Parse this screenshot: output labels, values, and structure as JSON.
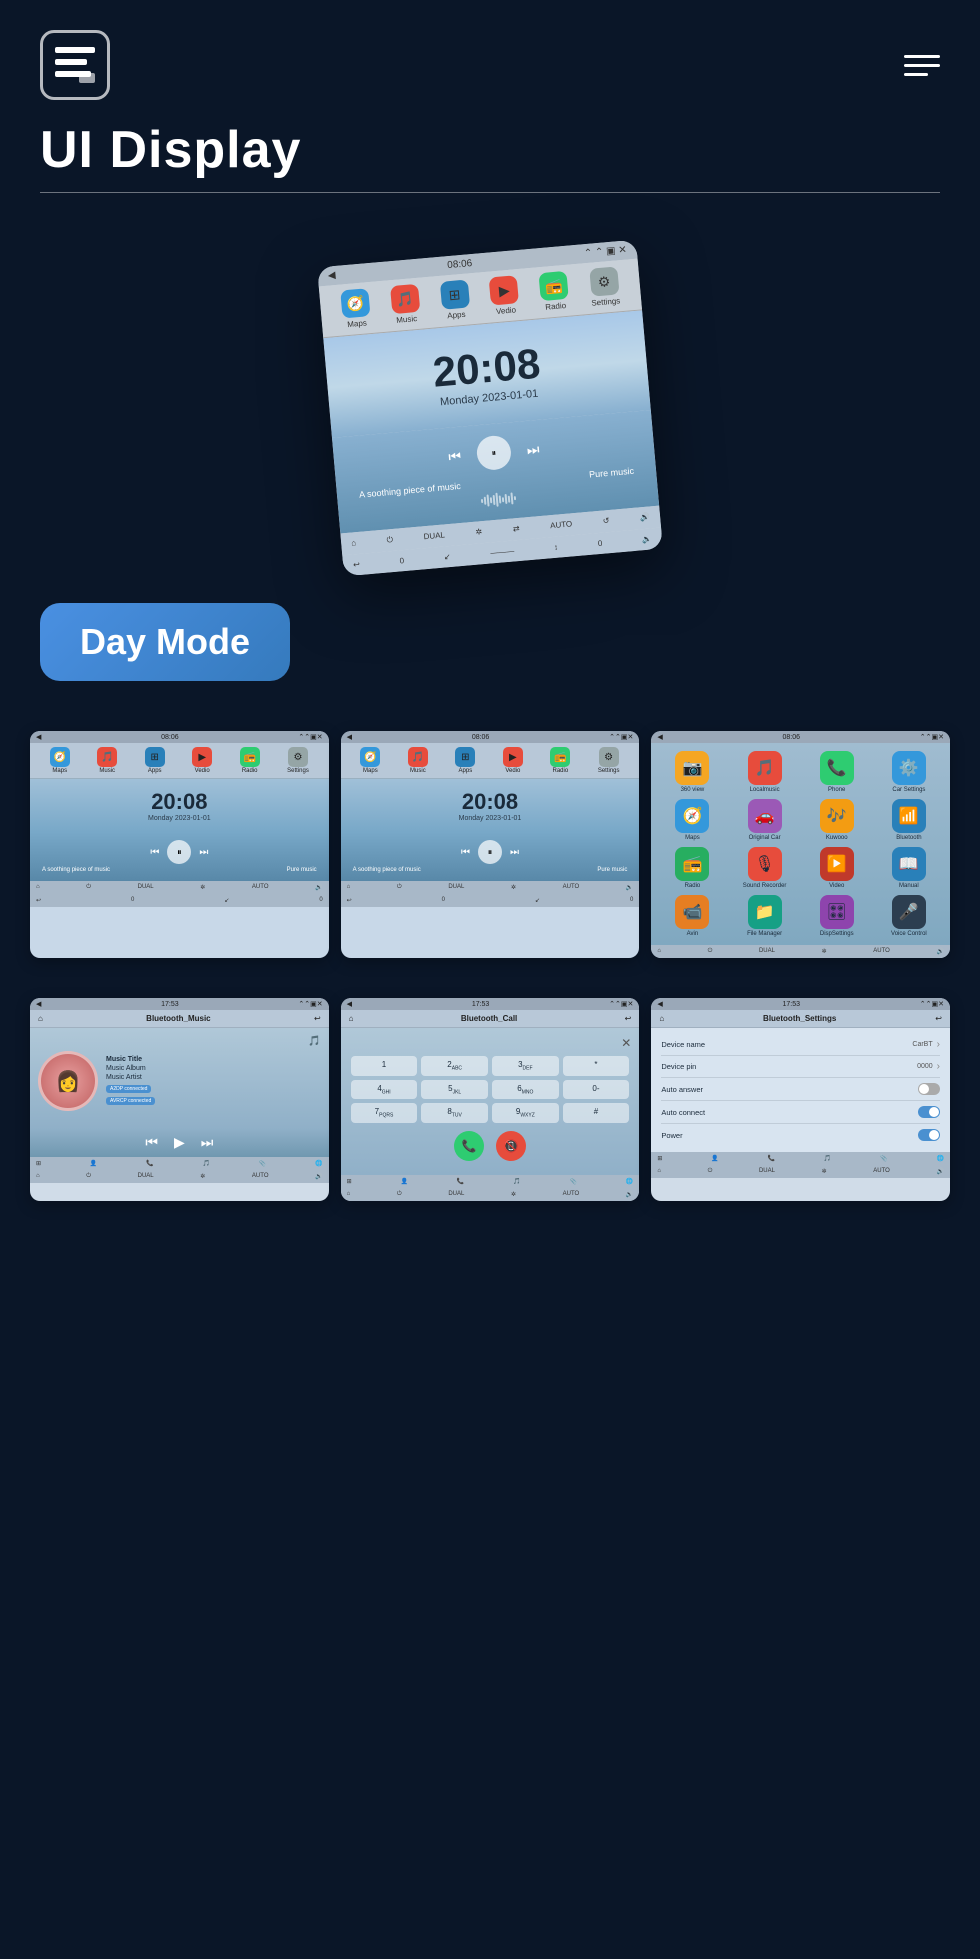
{
  "header": {
    "title": "UI Display",
    "logo_symbol": "≡",
    "menu_label": "Menu"
  },
  "hero": {
    "clock_time": "20:08",
    "clock_date": "Monday  2023-01-01",
    "music_text": "A soothing piece of music",
    "music_right": "Pure music"
  },
  "day_mode": {
    "label": "Day Mode"
  },
  "grid_row1": [
    {
      "time": "08:06",
      "clock": "20:08",
      "date": "Monday  2023-01-01",
      "music": "A soothing piece of music",
      "music_right": "Pure music",
      "apps": [
        "Maps",
        "Music",
        "Apps",
        "Vedio",
        "Radio",
        "Settings"
      ]
    },
    {
      "time": "08:06",
      "clock": "20:08",
      "date": "Monday  2023-01-01",
      "music": "A soothing piece of music",
      "music_right": "Pure music",
      "apps": [
        "Maps",
        "Music",
        "Apps",
        "Vedio",
        "Radio",
        "Settings"
      ]
    },
    {
      "time": "08:06",
      "type": "app_grid",
      "apps": [
        {
          "name": "360 view",
          "color": "#f5a623",
          "emoji": "📷"
        },
        {
          "name": "Localmusic",
          "color": "#e74c3c",
          "emoji": "🎵"
        },
        {
          "name": "Phone",
          "color": "#2ecc71",
          "emoji": "📞"
        },
        {
          "name": "Car Settings",
          "color": "#3498db",
          "emoji": "⚙️"
        },
        {
          "name": "Maps",
          "color": "#3498db",
          "emoji": "🧭"
        },
        {
          "name": "Original Car",
          "color": "#9b59b6",
          "emoji": "🚗"
        },
        {
          "name": "Kuwooo",
          "color": "#f39c12",
          "emoji": "🎶"
        },
        {
          "name": "Bluetooth",
          "color": "#2980b9",
          "emoji": "📶"
        },
        {
          "name": "Radio",
          "color": "#27ae60",
          "emoji": "📻"
        },
        {
          "name": "Sound Recorder",
          "color": "#e74c3c",
          "emoji": "🎙"
        },
        {
          "name": "Video",
          "color": "#e74c3c",
          "emoji": "▶️"
        },
        {
          "name": "Manual",
          "color": "#2980b9",
          "emoji": "📖"
        },
        {
          "name": "Avin",
          "color": "#e67e22",
          "emoji": "📹"
        },
        {
          "name": "File Manager",
          "color": "#16a085",
          "emoji": "📁"
        },
        {
          "name": "DispSettings",
          "color": "#8e44ad",
          "emoji": "🎛"
        },
        {
          "name": "Voice Control",
          "color": "#2c3e50",
          "emoji": "🎤"
        }
      ]
    }
  ],
  "grid_row2": [
    {
      "time": "17:53",
      "type": "bt_music",
      "header": "Bluetooth_Music",
      "music_title": "Music Title",
      "music_album": "Music Album",
      "music_artist": "Music Artist",
      "badge1": "A2DP connected",
      "badge2": "AVRCP connected"
    },
    {
      "time": "17:53",
      "type": "bt_call",
      "header": "Bluetooth_Call",
      "keys": [
        "1",
        "2ABC",
        "3DEF",
        "*",
        "4GHI",
        "5JKL",
        "6MNO",
        "0-",
        "7PQRS",
        "8TUV",
        "9WXYZ",
        "#"
      ]
    },
    {
      "time": "17:53",
      "type": "bt_settings",
      "header": "Bluetooth_Settings",
      "settings": [
        {
          "label": "Device name",
          "value": "CarBT",
          "type": "arrow"
        },
        {
          "label": "Device pin",
          "value": "0000",
          "type": "arrow"
        },
        {
          "label": "Auto answer",
          "value": "",
          "type": "toggle_off"
        },
        {
          "label": "Auto connect",
          "value": "",
          "type": "toggle_on"
        },
        {
          "label": "Power",
          "value": "",
          "type": "toggle_on"
        }
      ]
    }
  ],
  "colors": {
    "bg": "#0a1628",
    "accent_blue": "#4a90e2",
    "maps_blue": "#3498db",
    "music_red": "#e74c3c",
    "apps_blue": "#2980b9",
    "video_red": "#c0392b",
    "radio_green": "#27ae60",
    "settings_gray": "#95a5a6",
    "toggle_on": "#4a90d0",
    "toggle_off": "#aaaaaa"
  }
}
